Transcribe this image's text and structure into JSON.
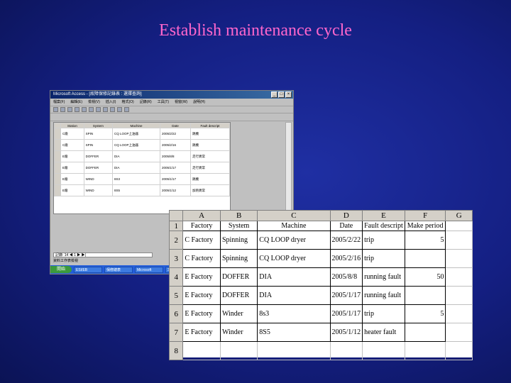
{
  "slide": {
    "title": "Establish maintenance cycle"
  },
  "access_window": {
    "title": "Microsoft Access - [故障保修記錄表 : 選擇查詢]",
    "menu": [
      "檔案(F)",
      "編輯(E)",
      "檢視(V)",
      "插入(I)",
      "格式(O)",
      "記錄(R)",
      "工具(T)",
      "視窗(W)",
      "說明(H)"
    ],
    "columns": [
      "Station",
      "System",
      "Machine",
      "Date",
      "Fault descript"
    ],
    "rows": [
      [
        "C廠",
        "SPIN",
        "CQ LOOP上油器",
        "2005/2/22",
        "跳機"
      ],
      [
        "C廠",
        "SPIN",
        "CQ LOOP上油器",
        "2005/2/16",
        "跳機"
      ],
      [
        "E廠",
        "DOFFER",
        "DIA",
        "2005/8/8",
        "走行異常"
      ],
      [
        "E廠",
        "DOFFER",
        "DIA",
        "2005/1/17",
        "走行異常"
      ],
      [
        "E廠",
        "WIND",
        "8S3",
        "2005/1/17",
        "跳機"
      ],
      [
        "E廠",
        "WIND",
        "8S5",
        "2005/1/12",
        "加熱異常"
      ]
    ],
    "record_nav": "記錄: 14 ◀ 1 ▶ ▶|",
    "status": "資料工作表檢視",
    "taskbar": {
      "start": "開始",
      "tasks": [
        "ESI/EB",
        "保修總表",
        "Microsoft",
        "3"
      ]
    }
  },
  "spreadsheet": {
    "column_headers": [
      "A",
      "B",
      "C",
      "D",
      "E",
      "F",
      "G"
    ],
    "row_numbers": [
      "1",
      "2",
      "3",
      "4",
      "5",
      "6",
      "7",
      "8"
    ],
    "header": [
      "Factory",
      "System",
      "Machine",
      "Date",
      "Fault descript",
      "Make period",
      ""
    ],
    "rows": [
      [
        "C Factory",
        "Spinning",
        "CQ LOOP dryer",
        "2005/2/22",
        "trip",
        "5",
        ""
      ],
      [
        "C Factory",
        "Spinning",
        "CQ LOOP dryer",
        "2005/2/16",
        "trip",
        "",
        ""
      ],
      [
        "E Factory",
        "DOFFER",
        "DIA",
        "2005/8/8",
        "running fault",
        "50",
        ""
      ],
      [
        "E Factory",
        "DOFFER",
        "DIA",
        "2005/1/17",
        "running fault",
        "",
        ""
      ],
      [
        "E Factory",
        "Winder",
        "8s3",
        "2005/1/17",
        "trip",
        "5",
        ""
      ],
      [
        "E Factory",
        "Winder",
        "8S5",
        "2005/1/12",
        "heater fault",
        "",
        ""
      ],
      [
        "",
        "",
        "",
        "",
        "",
        "",
        ""
      ]
    ]
  }
}
